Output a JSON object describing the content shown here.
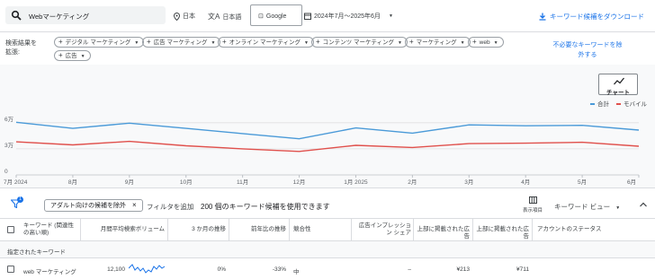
{
  "search": {
    "query": "Webマーケティング"
  },
  "filters": {
    "location": "日本",
    "language": "日本語",
    "network": "Google",
    "date_range": "2024年7月〜2025年6月"
  },
  "download_label": "キーワード候補をダウンロード",
  "broaden": {
    "label": "検索結果を拡張:",
    "chips": [
      "デジタル マーケティング",
      "広告 マーケティング",
      "オンライン マーケティング",
      "コンテンツ マーケティング",
      "マーケティング",
      "web",
      "広告"
    ]
  },
  "exclude_label": "不必要なキーワードを除外する",
  "chart_toggle_label": "チャート",
  "legend": [
    "合計",
    "モバイル"
  ],
  "filterbar": {
    "badge": "1",
    "chip_label": "アダルト向けの候補を除外",
    "add_filter": "フィルタを追加",
    "summary": "200 個のキーワード候補を使用できます",
    "columns_label": "表示項目",
    "view_label": "キーワード ビュー"
  },
  "table": {
    "headers": [
      "キーワード (関連性の高い順)",
      "月間平均検索ボリューム",
      "3 か月の推移",
      "前年比の推移",
      "競合性",
      "広告インプレッション シェア",
      "上部に掲載された広告",
      "上部に掲載された広告",
      "アカウントのステータス"
    ],
    "section_label": "指定されたキーワード",
    "rows": [
      {
        "keyword": "web マーケティング",
        "volume": "12,100",
        "three_month": "0%",
        "yoy": "-33%",
        "competition": "中",
        "impression_share": "–",
        "top_low": "¥213",
        "top_high": "¥711",
        "status": ""
      }
    ]
  },
  "colors": {
    "total": "#4a9ad8",
    "mobile": "#e0504c",
    "accent": "#1a73e8"
  },
  "chart_data": {
    "type": "line",
    "x": [
      "7月 2024",
      "8月",
      "9月",
      "10月",
      "11月",
      "12月",
      "1月 2025",
      "2月",
      "3月",
      "4月",
      "5月",
      "6月"
    ],
    "yticks": [
      "0",
      "3万",
      "6万"
    ],
    "ylim": [
      0,
      67000
    ],
    "series": [
      {
        "name": "合計",
        "values": [
          60500,
          53500,
          59500,
          53500,
          47500,
          41500,
          54000,
          48000,
          57500,
          56500,
          57000,
          51500
        ]
      },
      {
        "name": "モバイル",
        "values": [
          38000,
          34500,
          38500,
          33500,
          30000,
          27000,
          34000,
          31500,
          36000,
          36500,
          37500,
          33000
        ]
      }
    ]
  }
}
